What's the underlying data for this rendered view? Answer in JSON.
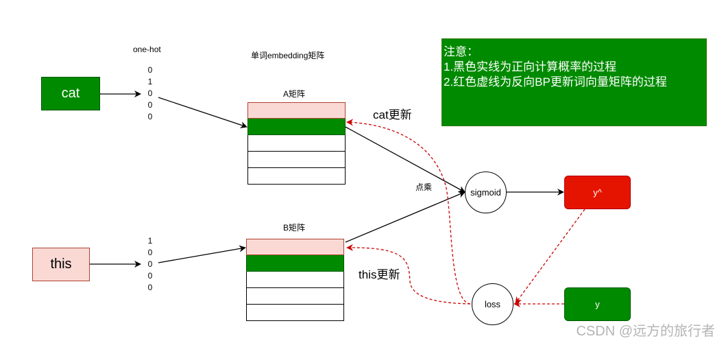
{
  "labels": {
    "onehot_title": "one-hot",
    "embedding_title": "单词embedding矩阵",
    "matrix_a_title": "A矩阵",
    "matrix_b_title": "B矩阵",
    "dot_product": "点乘",
    "cat_update": "cat更新",
    "this_update": "this更新"
  },
  "words": {
    "cat": "cat",
    "this": "this"
  },
  "onehot_cat": [
    "0",
    "1",
    "0",
    "0",
    "0"
  ],
  "onehot_this": [
    "1",
    "0",
    "0",
    "0",
    "0"
  ],
  "nodes": {
    "sigmoid": "sigmoid",
    "loss": "loss",
    "y_hat": "y^",
    "y": "y"
  },
  "note": {
    "title": "注意：",
    "line1": "1.黑色实线为正向计算概率的过程",
    "line2": "2.红色虚线为反向BP更新词向量矩阵的过程"
  },
  "watermark": "CSDN @远方的旅行者",
  "colors": {
    "green": "#008a00",
    "pink": "#fad9d5",
    "red": "#e51400",
    "dashed_red": "#cc0000"
  }
}
